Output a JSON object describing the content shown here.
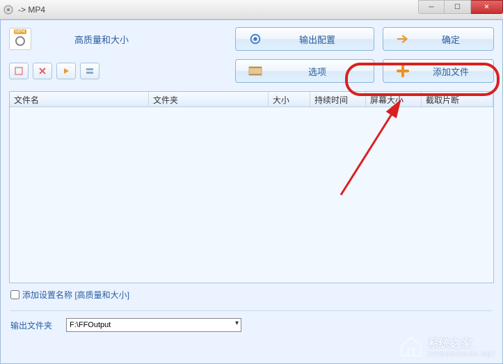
{
  "titlebar": {
    "title": "-> MP4"
  },
  "top": {
    "quality_label": "高质量和大小",
    "output_config_btn": "输出配置",
    "ok_btn": "确定",
    "options_btn": "选项",
    "add_file_btn": "添加文件"
  },
  "table": {
    "columns": {
      "name": "文件名",
      "folder": "文件夹",
      "size": "大小",
      "duration": "持续时间",
      "screen": "屏幕大小",
      "clip": "截取片断"
    }
  },
  "bottom": {
    "checkbox_label": "添加设置名称  [高质量和大小]",
    "output_folder_label": "输出文件夹",
    "output_folder_value": "F:\\FFOutput"
  },
  "watermark": {
    "brand": "系统之家",
    "url": "XITONGZHIJIA.NET"
  }
}
